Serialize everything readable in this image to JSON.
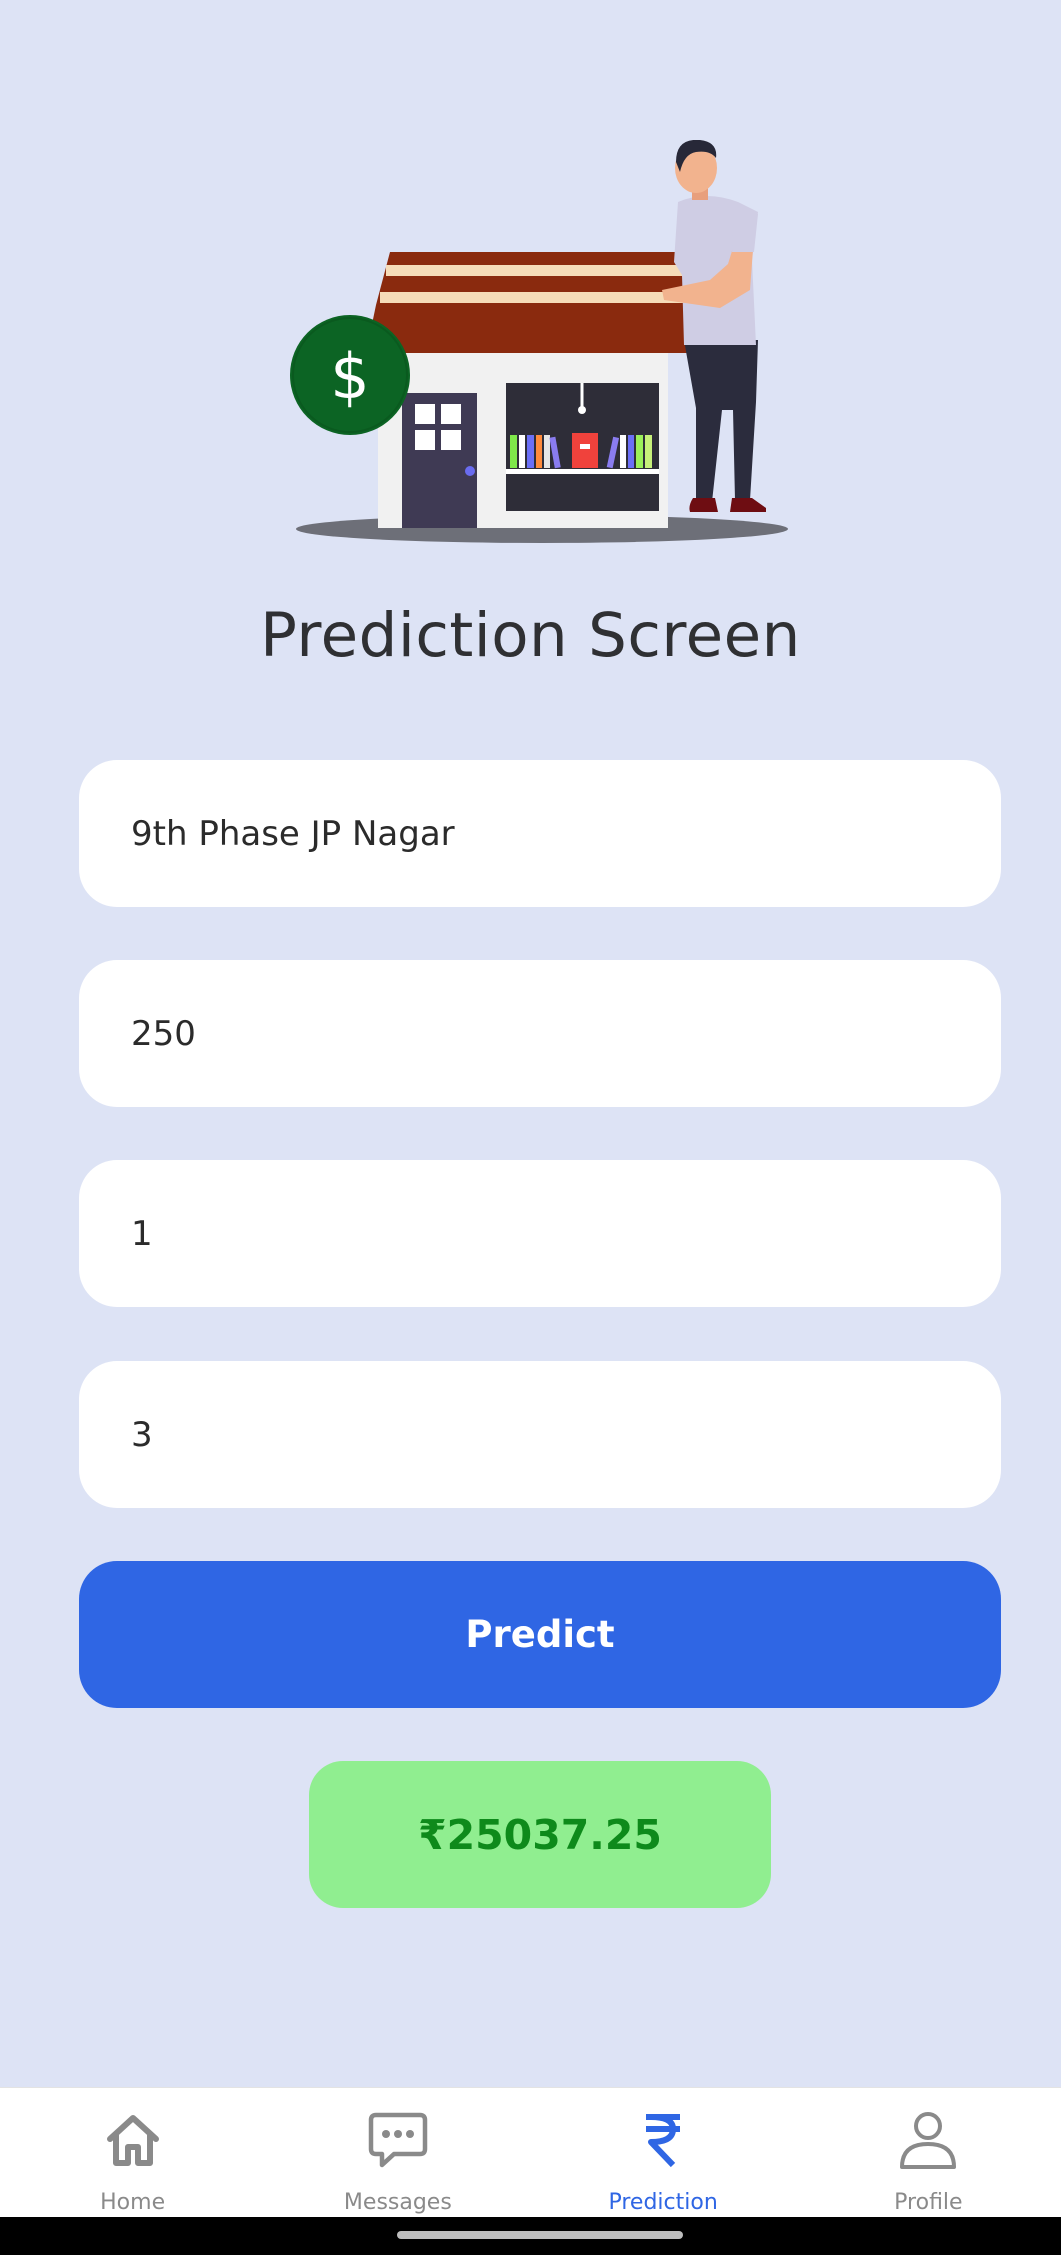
{
  "screen": {
    "title": "Prediction Screen"
  },
  "hero": {
    "dollar_symbol": "$"
  },
  "form": {
    "location_value": "9th Phase JP Nagar",
    "area_value": "250",
    "bath_value": "1",
    "bhk_value": "3",
    "predict_label": "Predict"
  },
  "result": {
    "price_text": "₹25037.25"
  },
  "nav": {
    "items": [
      {
        "label": "Home",
        "icon": "home-icon"
      },
      {
        "label": "Messages",
        "icon": "chat-icon"
      },
      {
        "label": "Prediction",
        "icon": "rupee-icon"
      },
      {
        "label": "Profile",
        "icon": "person-icon"
      }
    ],
    "active": "Prediction"
  },
  "colors": {
    "background": "#dde3f5",
    "accent": "#2f66e4",
    "result_bg": "#90ee90",
    "result_text": "#0e8a1b",
    "inactive_nav": "#8a8a8a"
  }
}
